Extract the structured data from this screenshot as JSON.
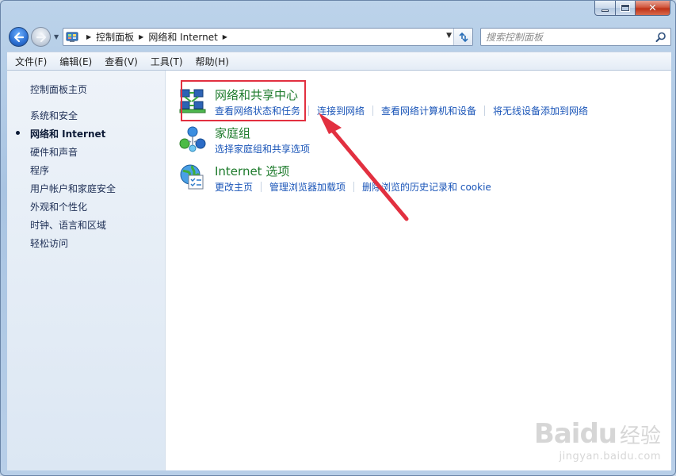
{
  "address": {
    "crumbs": [
      "控制面板",
      "网络和 Internet"
    ]
  },
  "search": {
    "placeholder": "搜索控制面板"
  },
  "menu": {
    "items": [
      "文件(F)",
      "编辑(E)",
      "查看(V)",
      "工具(T)",
      "帮助(H)"
    ]
  },
  "sidebar": {
    "items": [
      {
        "label": "控制面板主页"
      },
      {
        "label": "系统和安全"
      },
      {
        "label": "网络和 Internet",
        "current": true
      },
      {
        "label": "硬件和声音"
      },
      {
        "label": "程序"
      },
      {
        "label": "用户帐户和家庭安全"
      },
      {
        "label": "外观和个性化"
      },
      {
        "label": "时钟、语言和区域"
      },
      {
        "label": "轻松访问"
      }
    ]
  },
  "categories": [
    {
      "title": "网络和共享中心",
      "icon": "network-sharing-icon",
      "links": [
        "查看网络状态和任务",
        "连接到网络",
        "查看网络计算机和设备",
        "将无线设备添加到网络"
      ]
    },
    {
      "title": "家庭组",
      "icon": "homegroup-icon",
      "links": [
        "选择家庭组和共享选项"
      ]
    },
    {
      "title": "Internet 选项",
      "icon": "internet-options-icon",
      "links": [
        "更改主页",
        "管理浏览器加载项",
        "删除浏览的历史记录和 cookie"
      ]
    }
  ],
  "colors": {
    "category_title": "#1e7b2c",
    "link": "#1a55b8",
    "highlight": "#e23040"
  },
  "watermark": {
    "logo": "Bai",
    "logo2": "du",
    "cn": "经验",
    "url": "jingyan.baidu.com"
  }
}
